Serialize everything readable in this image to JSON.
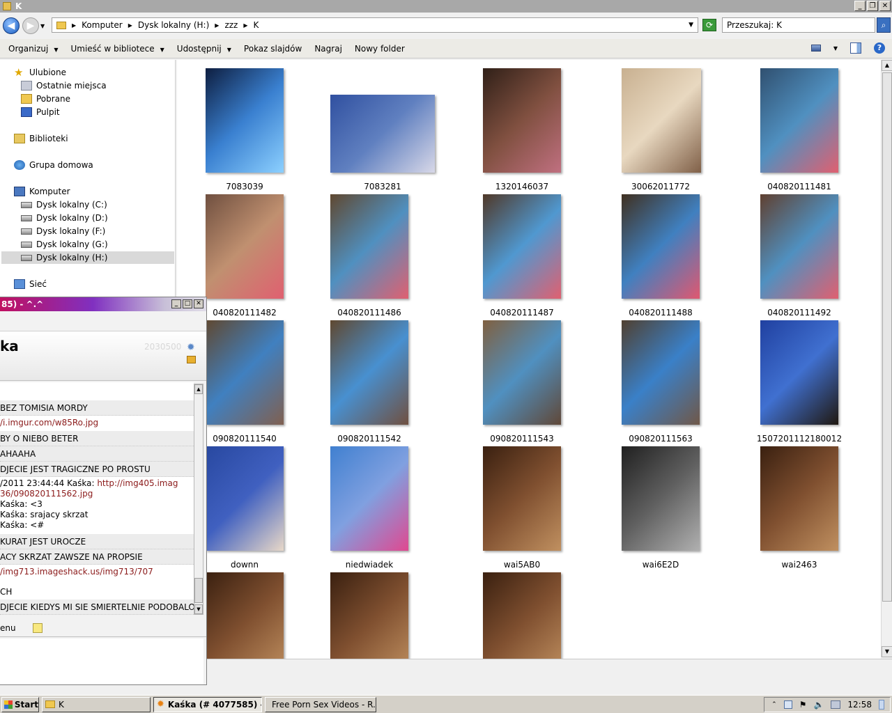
{
  "window": {
    "title": "K"
  },
  "address": {
    "crumbs": [
      "Komputer",
      "Dysk lokalny (H:)",
      "zzz",
      "K"
    ],
    "search_placeholder": "Przeszukaj: K"
  },
  "toolbar": {
    "items": [
      "Organizuj",
      "Umieść w bibliotece",
      "Udostępnij",
      "Pokaz slajdów",
      "Nagraj",
      "Nowy folder"
    ]
  },
  "nav": {
    "favorites": "Ulubione",
    "recent": "Ostatnie miejsca",
    "downloads": "Pobrane",
    "desktop": "Pulpit",
    "libraries": "Biblioteki",
    "homegroup": "Grupa domowa",
    "computer": "Komputer",
    "drives": [
      "Dysk lokalny (C:)",
      "Dysk lokalny (D:)",
      "Dysk lokalny (F:)",
      "Dysk lokalny (G:)",
      "Dysk lokalny (H:)"
    ],
    "network": "Sieć"
  },
  "files": [
    "7083039",
    "7083281",
    "1320146037",
    "30062011772",
    "040820111481",
    "040820111482",
    "040820111486",
    "040820111487",
    "040820111488",
    "040820111492",
    "090820111540",
    "090820111542",
    "090820111543",
    "090820111563",
    "1507201112180012",
    "downn",
    "niedwiadek",
    "wai5AB0",
    "wai6E2D",
    "wai2463",
    "",
    "",
    ""
  ],
  "chat": {
    "title": "85) - ^.^",
    "name": "ka",
    "score": "2030500",
    "messages": [
      "BEZ TOMISIA MORDY",
      "/i.imgur.com/w85Ro.jpg",
      "BY O NIEBO BETER",
      "AHAAHA",
      "DJECIE JEST TRAGICZNE PO PROSTU",
      "/2011 23:44:44 Kaśka: ",
      "http://img405.imag",
      "36/090820111562.jpg",
      "Kaśka: <3",
      "Kaśka: srajacy skrzat",
      "Kaśka: <#",
      "KURAT JEST UROCZE",
      "ACY SKRZAT ZAWSZE NA PROPSIE",
      "/img713.imageshack.us/img713/707",
      "CH",
      "DJECIE KIEDYS MI SIE SMIERTELNIE PODOBALO"
    ],
    "menu_label": "enu"
  },
  "taskbar": {
    "start": "Start",
    "tasks": [
      "K",
      "Kaśka (# 4077585) - ...",
      "Free Porn Sex Videos - R..."
    ],
    "clock": "12:58"
  }
}
